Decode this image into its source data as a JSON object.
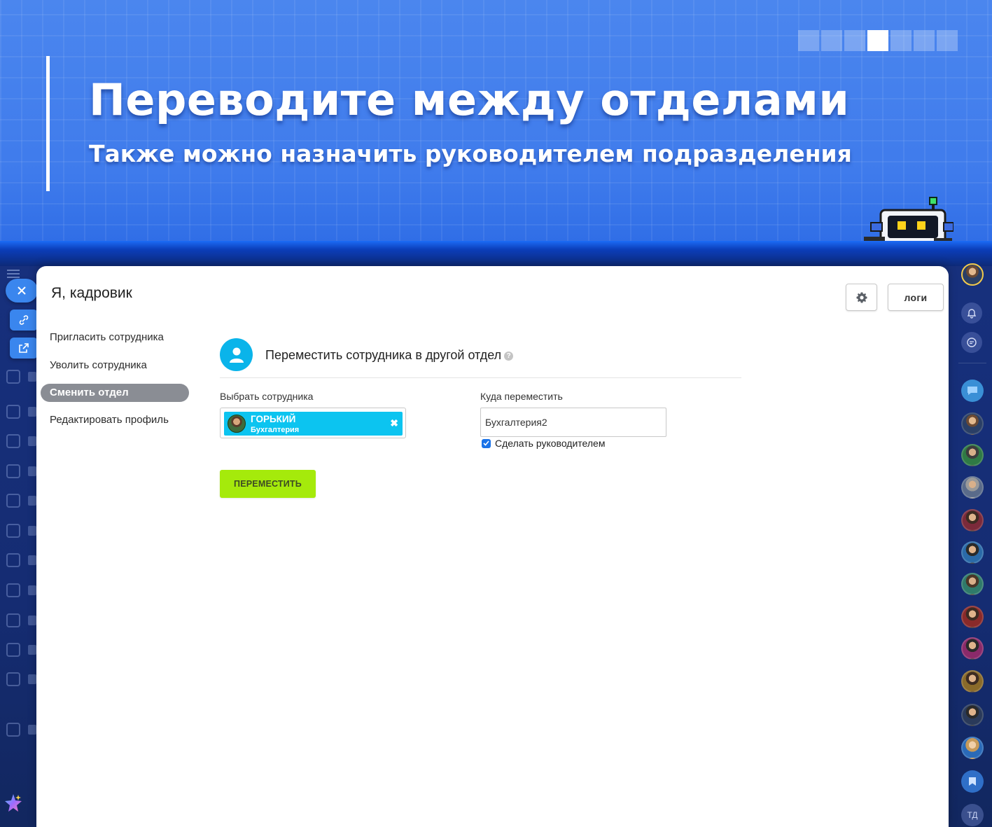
{
  "banner": {
    "title": "Переводите между отделами",
    "subtitle": "Также можно назначить руководителем подразделения",
    "pager": {
      "total": 7,
      "active_index": 3
    }
  },
  "panel": {
    "title": "Я, кадровик",
    "logs_label": "логи"
  },
  "side_menu": {
    "items": [
      {
        "label": "Пригласить сотрудника",
        "active": false
      },
      {
        "label": "Уволить сотрудника",
        "active": false
      },
      {
        "label": "Сменить отдел",
        "active": true
      },
      {
        "label": "Редактировать профиль",
        "active": false
      }
    ]
  },
  "section": {
    "title": "Переместить сотрудника в другой отдел",
    "help": "?"
  },
  "form": {
    "employee_label": "Выбрать сотрудника",
    "employee": {
      "name": "ГОРЬКИЙ",
      "department": "Бухгалтерия",
      "remove": "✖"
    },
    "target_label": "Куда переместить",
    "target_value": "Бухгалтерия2",
    "make_head_label": "Сделать руководителем",
    "make_head_checked": true,
    "submit_label": "ПЕРЕМЕСТИТЬ"
  },
  "right_rail": {
    "initials": "ТД"
  },
  "colors": {
    "banner_blue": "#4a86ee",
    "accent_cyan": "#0cc4f0",
    "submit_green": "#a5ea0b",
    "active_menu": "#8a8d94"
  }
}
